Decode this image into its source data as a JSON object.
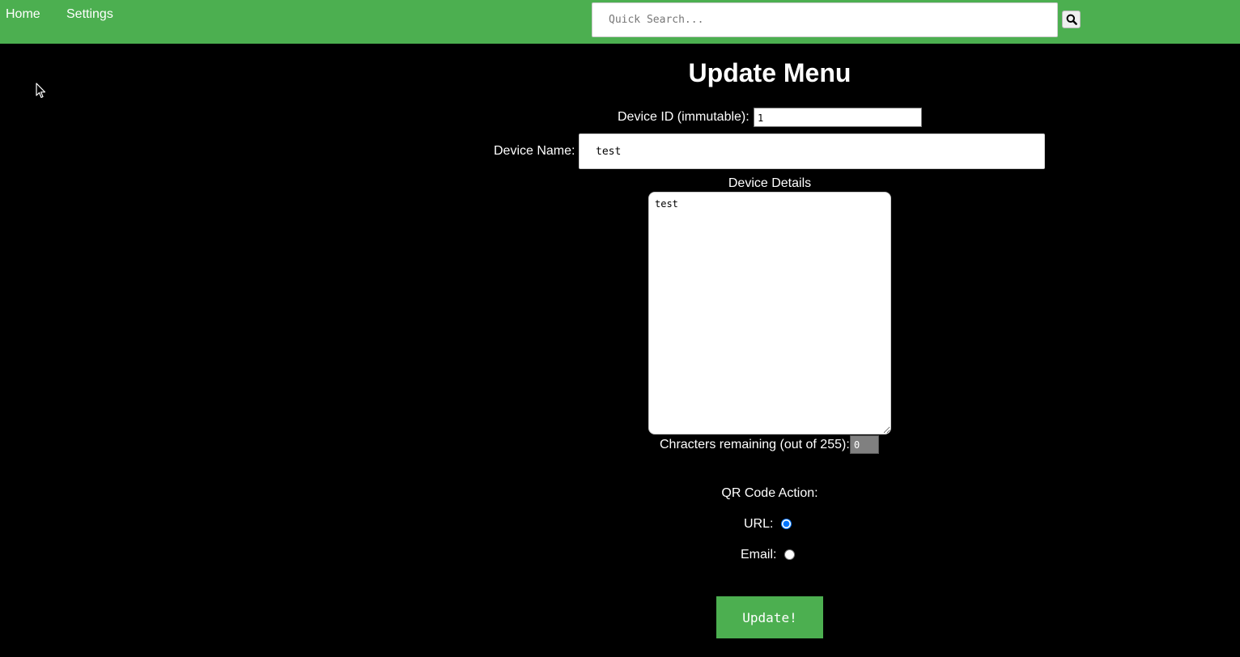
{
  "nav": {
    "home_label": "Home",
    "settings_label": "Settings"
  },
  "search": {
    "placeholder": "Quick Search...",
    "icon": "search-icon"
  },
  "form": {
    "title": "Update Menu",
    "device_id_label": "Device ID (immutable):",
    "device_id_value": "1",
    "device_name_label": "Device Name:",
    "device_name_value": "test",
    "device_details_label": "Device Details",
    "device_details_value": "test",
    "chars_remaining_label": "Chracters remaining (out of 255):",
    "chars_remaining_value": "0",
    "qr_action_label": "QR Code Action:",
    "qr_options": [
      {
        "label": "URL:",
        "checked": true
      },
      {
        "label": "Email:",
        "checked": false
      }
    ],
    "submit_label": "Update!"
  },
  "colors": {
    "accent": "#4caf50",
    "background": "#000000",
    "text": "#ffffff"
  }
}
